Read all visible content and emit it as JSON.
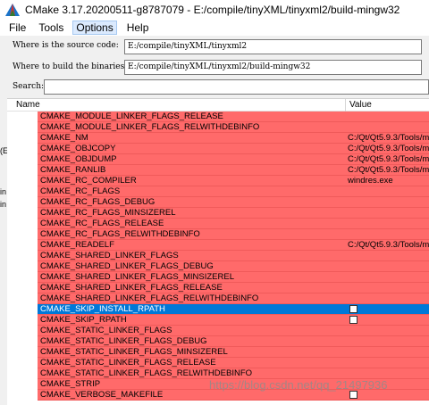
{
  "window": {
    "title": "CMake 3.17.20200511-g8787079 - E:/compile/tinyXML/tinyxml2/build-mingw32"
  },
  "menu": {
    "items": [
      "File",
      "Tools",
      "Options",
      "Help"
    ]
  },
  "form": {
    "source_label": "Where is the source code:",
    "source_value": "E:/compile/tinyXML/tinyxml2",
    "build_label": "Where to build the binaries:",
    "build_value": "E:/compile/tinyXML/tinyxml2/build-mingw32",
    "search_label": "Search:",
    "search_value": ""
  },
  "left_strip": {
    "fragments": [
      "(E",
      "in",
      "in"
    ]
  },
  "table": {
    "columns": [
      "Name",
      "Value"
    ],
    "rows": [
      {
        "name": "CMAKE_MODULE_LINKER_FLAGS_RELEASE",
        "value": ""
      },
      {
        "name": "CMAKE_MODULE_LINKER_FLAGS_RELWITHDEBINFO",
        "value": ""
      },
      {
        "name": "CMAKE_NM",
        "value": "C:/Qt/Qt5.9.3/Tools/m"
      },
      {
        "name": "CMAKE_OBJCOPY",
        "value": "C:/Qt/Qt5.9.3/Tools/m"
      },
      {
        "name": "CMAKE_OBJDUMP",
        "value": "C:/Qt/Qt5.9.3/Tools/m"
      },
      {
        "name": "CMAKE_RANLIB",
        "value": "C:/Qt/Qt5.9.3/Tools/m"
      },
      {
        "name": "CMAKE_RC_COMPILER",
        "value": "windres.exe"
      },
      {
        "name": "CMAKE_RC_FLAGS",
        "value": ""
      },
      {
        "name": "CMAKE_RC_FLAGS_DEBUG",
        "value": ""
      },
      {
        "name": "CMAKE_RC_FLAGS_MINSIZEREL",
        "value": ""
      },
      {
        "name": "CMAKE_RC_FLAGS_RELEASE",
        "value": ""
      },
      {
        "name": "CMAKE_RC_FLAGS_RELWITHDEBINFO",
        "value": ""
      },
      {
        "name": "CMAKE_READELF",
        "value": "C:/Qt/Qt5.9.3/Tools/m"
      },
      {
        "name": "CMAKE_SHARED_LINKER_FLAGS",
        "value": ""
      },
      {
        "name": "CMAKE_SHARED_LINKER_FLAGS_DEBUG",
        "value": ""
      },
      {
        "name": "CMAKE_SHARED_LINKER_FLAGS_MINSIZEREL",
        "value": ""
      },
      {
        "name": "CMAKE_SHARED_LINKER_FLAGS_RELEASE",
        "value": ""
      },
      {
        "name": "CMAKE_SHARED_LINKER_FLAGS_RELWITHDEBINFO",
        "value": ""
      },
      {
        "name": "CMAKE_SKIP_INSTALL_RPATH",
        "value": "",
        "checkbox": true,
        "selected": true
      },
      {
        "name": "CMAKE_SKIP_RPATH",
        "value": "",
        "checkbox": true
      },
      {
        "name": "CMAKE_STATIC_LINKER_FLAGS",
        "value": ""
      },
      {
        "name": "CMAKE_STATIC_LINKER_FLAGS_DEBUG",
        "value": ""
      },
      {
        "name": "CMAKE_STATIC_LINKER_FLAGS_MINSIZEREL",
        "value": ""
      },
      {
        "name": "CMAKE_STATIC_LINKER_FLAGS_RELEASE",
        "value": ""
      },
      {
        "name": "CMAKE_STATIC_LINKER_FLAGS_RELWITHDEBINFO",
        "value": ""
      },
      {
        "name": "CMAKE_STRIP",
        "value": ""
      },
      {
        "name": "CMAKE_VERBOSE_MAKEFILE",
        "value": "",
        "checkbox": true
      }
    ]
  },
  "watermark": "https://blog.csdn.net/qq_21497936",
  "colors": {
    "row_red": "#ff6a6a",
    "selection_blue": "#0078d7"
  }
}
